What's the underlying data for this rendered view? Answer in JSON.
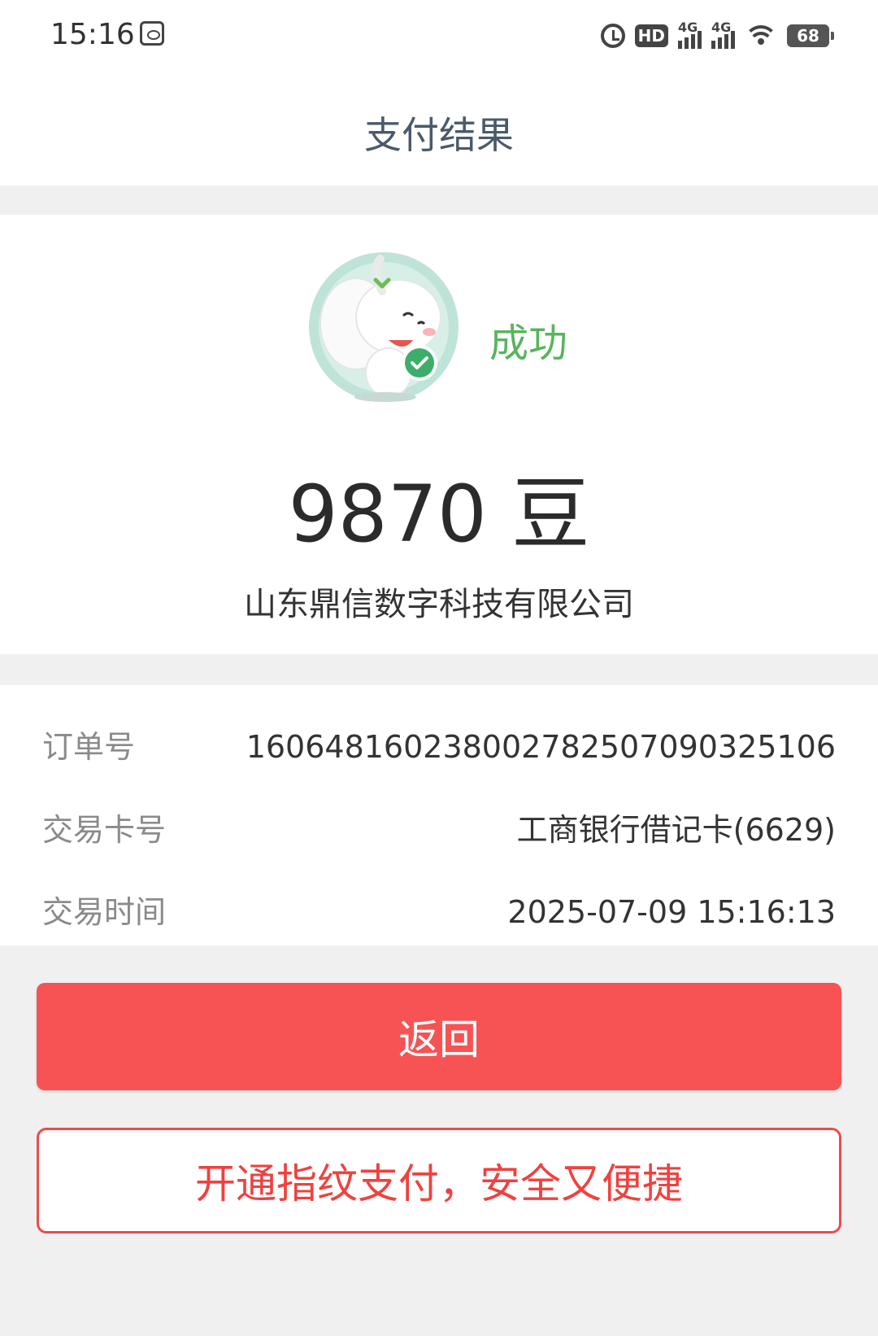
{
  "status_bar": {
    "time": "15:16",
    "hd_label": "HD",
    "net1_label": "4G",
    "net2_label": "4G",
    "battery": "68"
  },
  "header": {
    "title": "支付结果"
  },
  "result": {
    "status": "成功",
    "amount": "9870 豆",
    "merchant": "山东鼎信数字科技有限公司"
  },
  "details": [
    {
      "label": "订单号",
      "value": "1606481602380027825070903251​06"
    },
    {
      "label": "交易卡号",
      "value": "工商银行借记卡(6629)"
    },
    {
      "label": "交易时间",
      "value": "2025-07-09 15:16:13"
    }
  ],
  "actions": {
    "back_label": "返回",
    "fingerprint_label": "开通指纹支付，安全又便捷"
  },
  "colors": {
    "primary_red": "#f75354",
    "success_green": "#57b55c"
  }
}
